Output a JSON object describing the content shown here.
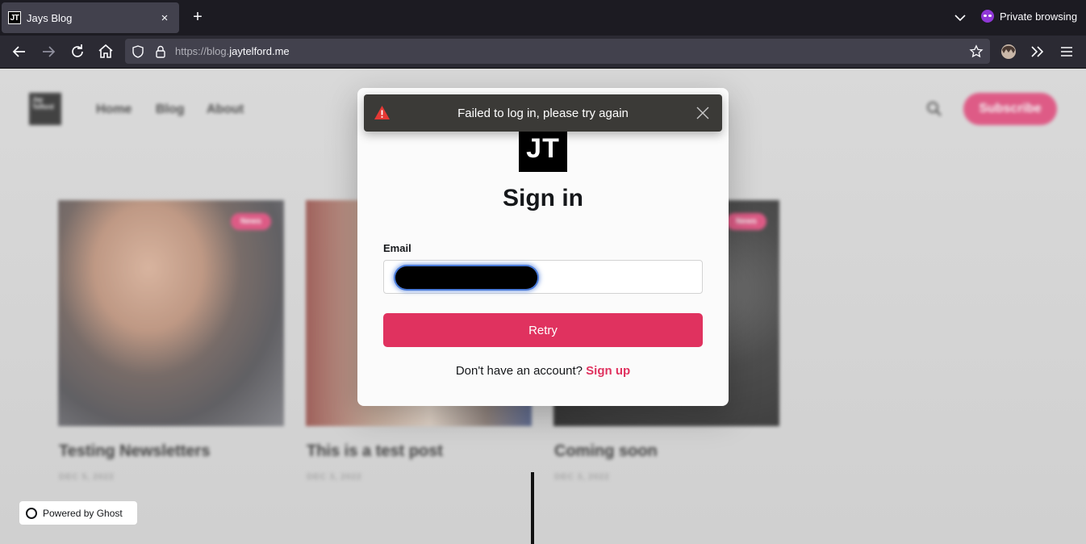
{
  "browser": {
    "tab_title": "Jays Blog",
    "tab_favicon_text": "JT",
    "tab_close": "×",
    "new_tab": "+",
    "private_label": "Private browsing",
    "url_prefix": "https://blog.",
    "url_domain": "jaytelford.me"
  },
  "site": {
    "logo_text": "Jay Telford",
    "nav": [
      "Home",
      "Blog",
      "About"
    ],
    "subscribe_label": "Subscribe",
    "posts": [
      {
        "title": "Testing Newsletters",
        "date": "DEC 5, 2022",
        "tag": "News"
      },
      {
        "title": "This is a test post",
        "date": "DEC 3, 2022",
        "tag": ""
      },
      {
        "title": "Coming soon",
        "date": "DEC 3, 2022",
        "tag": "News"
      }
    ],
    "powered_by": "Powered by Ghost"
  },
  "modal": {
    "logo_text": "JT",
    "title": "Sign in",
    "email_label": "Email",
    "retry_label": "Retry",
    "signup_prompt": "Don't have an account?",
    "signup_link": "Sign up"
  },
  "toast": {
    "message": "Failed to log in, please try again"
  },
  "colors": {
    "accent": "#e0325f",
    "toast_bg": "#3b3a37",
    "warning": "#e53935"
  }
}
